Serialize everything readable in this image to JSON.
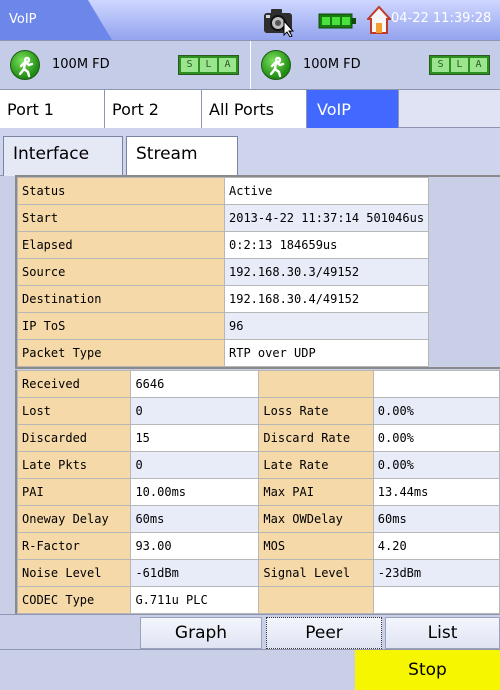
{
  "header": {
    "app_title": "VoIP",
    "clock": "04-22 11:39:28",
    "icons": [
      "camera-icon",
      "battery-icon",
      "home-icon"
    ]
  },
  "link_status": [
    {
      "speed": "100M FD",
      "sla": [
        "S",
        "L",
        "A"
      ]
    },
    {
      "speed": "100M FD",
      "sla": [
        "S",
        "L",
        "A"
      ]
    }
  ],
  "port_tabs": [
    "Port 1",
    "Port 2",
    "All Ports",
    "VoIP"
  ],
  "active_port_tab": "VoIP",
  "sub_tabs": [
    "Interface",
    "Stream"
  ],
  "active_sub_tab": "Stream",
  "stream_info": [
    {
      "label": "Status",
      "value": "Active"
    },
    {
      "label": "Start",
      "value": "2013-4-22 11:37:14 501046us"
    },
    {
      "label": "Elapsed",
      "value": "0:2:13 184659us"
    },
    {
      "label": "Source",
      "value": "192.168.30.3/49152"
    },
    {
      "label": "Destination",
      "value": "192.168.30.4/49152"
    },
    {
      "label": "IP ToS",
      "value": "96"
    },
    {
      "label": "Packet Type",
      "value": "RTP over UDP"
    }
  ],
  "stats": [
    {
      "label": "Received",
      "value": "6646",
      "label2": "",
      "value2": ""
    },
    {
      "label": "Lost",
      "value": "0",
      "label2": "Loss Rate",
      "value2": "0.00%"
    },
    {
      "label": "Discarded",
      "value": "15",
      "label2": "Discard Rate",
      "value2": "0.00%"
    },
    {
      "label": "Late Pkts",
      "value": "0",
      "label2": "Late Rate",
      "value2": "0.00%"
    },
    {
      "label": "PAI",
      "value": "10.00ms",
      "label2": "Max PAI",
      "value2": "13.44ms"
    },
    {
      "label": "Oneway Delay",
      "value": "60ms",
      "label2": "Max OWDelay",
      "value2": "60ms"
    },
    {
      "label": "R-Factor",
      "value": "93.00",
      "label2": "MOS",
      "value2": "4.20"
    },
    {
      "label": "Noise Level",
      "value": "-61dBm",
      "label2": "Signal Level",
      "value2": "-23dBm"
    },
    {
      "label": "CODEC Type",
      "value": "G.711u PLC",
      "label2": "",
      "value2": ""
    }
  ],
  "buttons": {
    "graph": "Graph",
    "peer": "Peer",
    "list": "List",
    "stop": "Stop"
  }
}
